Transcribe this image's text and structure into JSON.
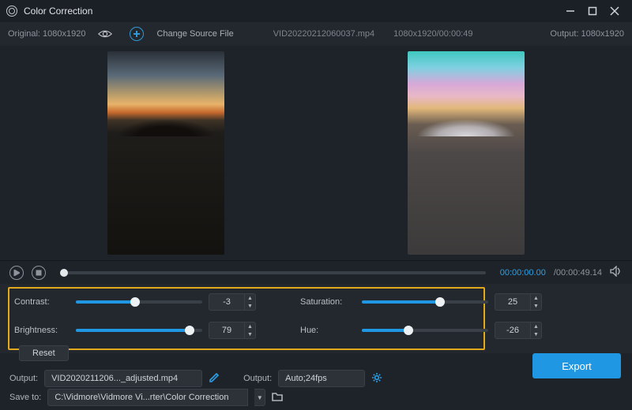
{
  "titlebar": {
    "title": "Color Correction"
  },
  "infobar": {
    "original_label": "Original: 1080x1920",
    "change_source_label": "Change Source File",
    "file_name": "VID20220212060037.mp4",
    "file_meta": "1080x1920/00:00:49",
    "output_label": "Output: 1080x1920"
  },
  "transport": {
    "current_time": "00:00:00.00",
    "total_time": "/00:00:49.14"
  },
  "sliders": {
    "contrast": {
      "label": "Contrast:",
      "value": "-3",
      "pct": 47
    },
    "brightness": {
      "label": "Brightness:",
      "value": "79",
      "pct": 90
    },
    "saturation": {
      "label": "Saturation:",
      "value": "25",
      "pct": 62
    },
    "hue": {
      "label": "Hue:",
      "value": "-26",
      "pct": 37
    }
  },
  "buttons": {
    "reset": "Reset",
    "export": "Export"
  },
  "output": {
    "output_label": "Output:",
    "output_filename": "VID2020211206..._adjusted.mp4",
    "output_settings_label": "Output:",
    "output_settings_value": "Auto;24fps",
    "saveto_label": "Save to:",
    "saveto_path": "C:\\Vidmore\\Vidmore Vi...rter\\Color Correction"
  }
}
